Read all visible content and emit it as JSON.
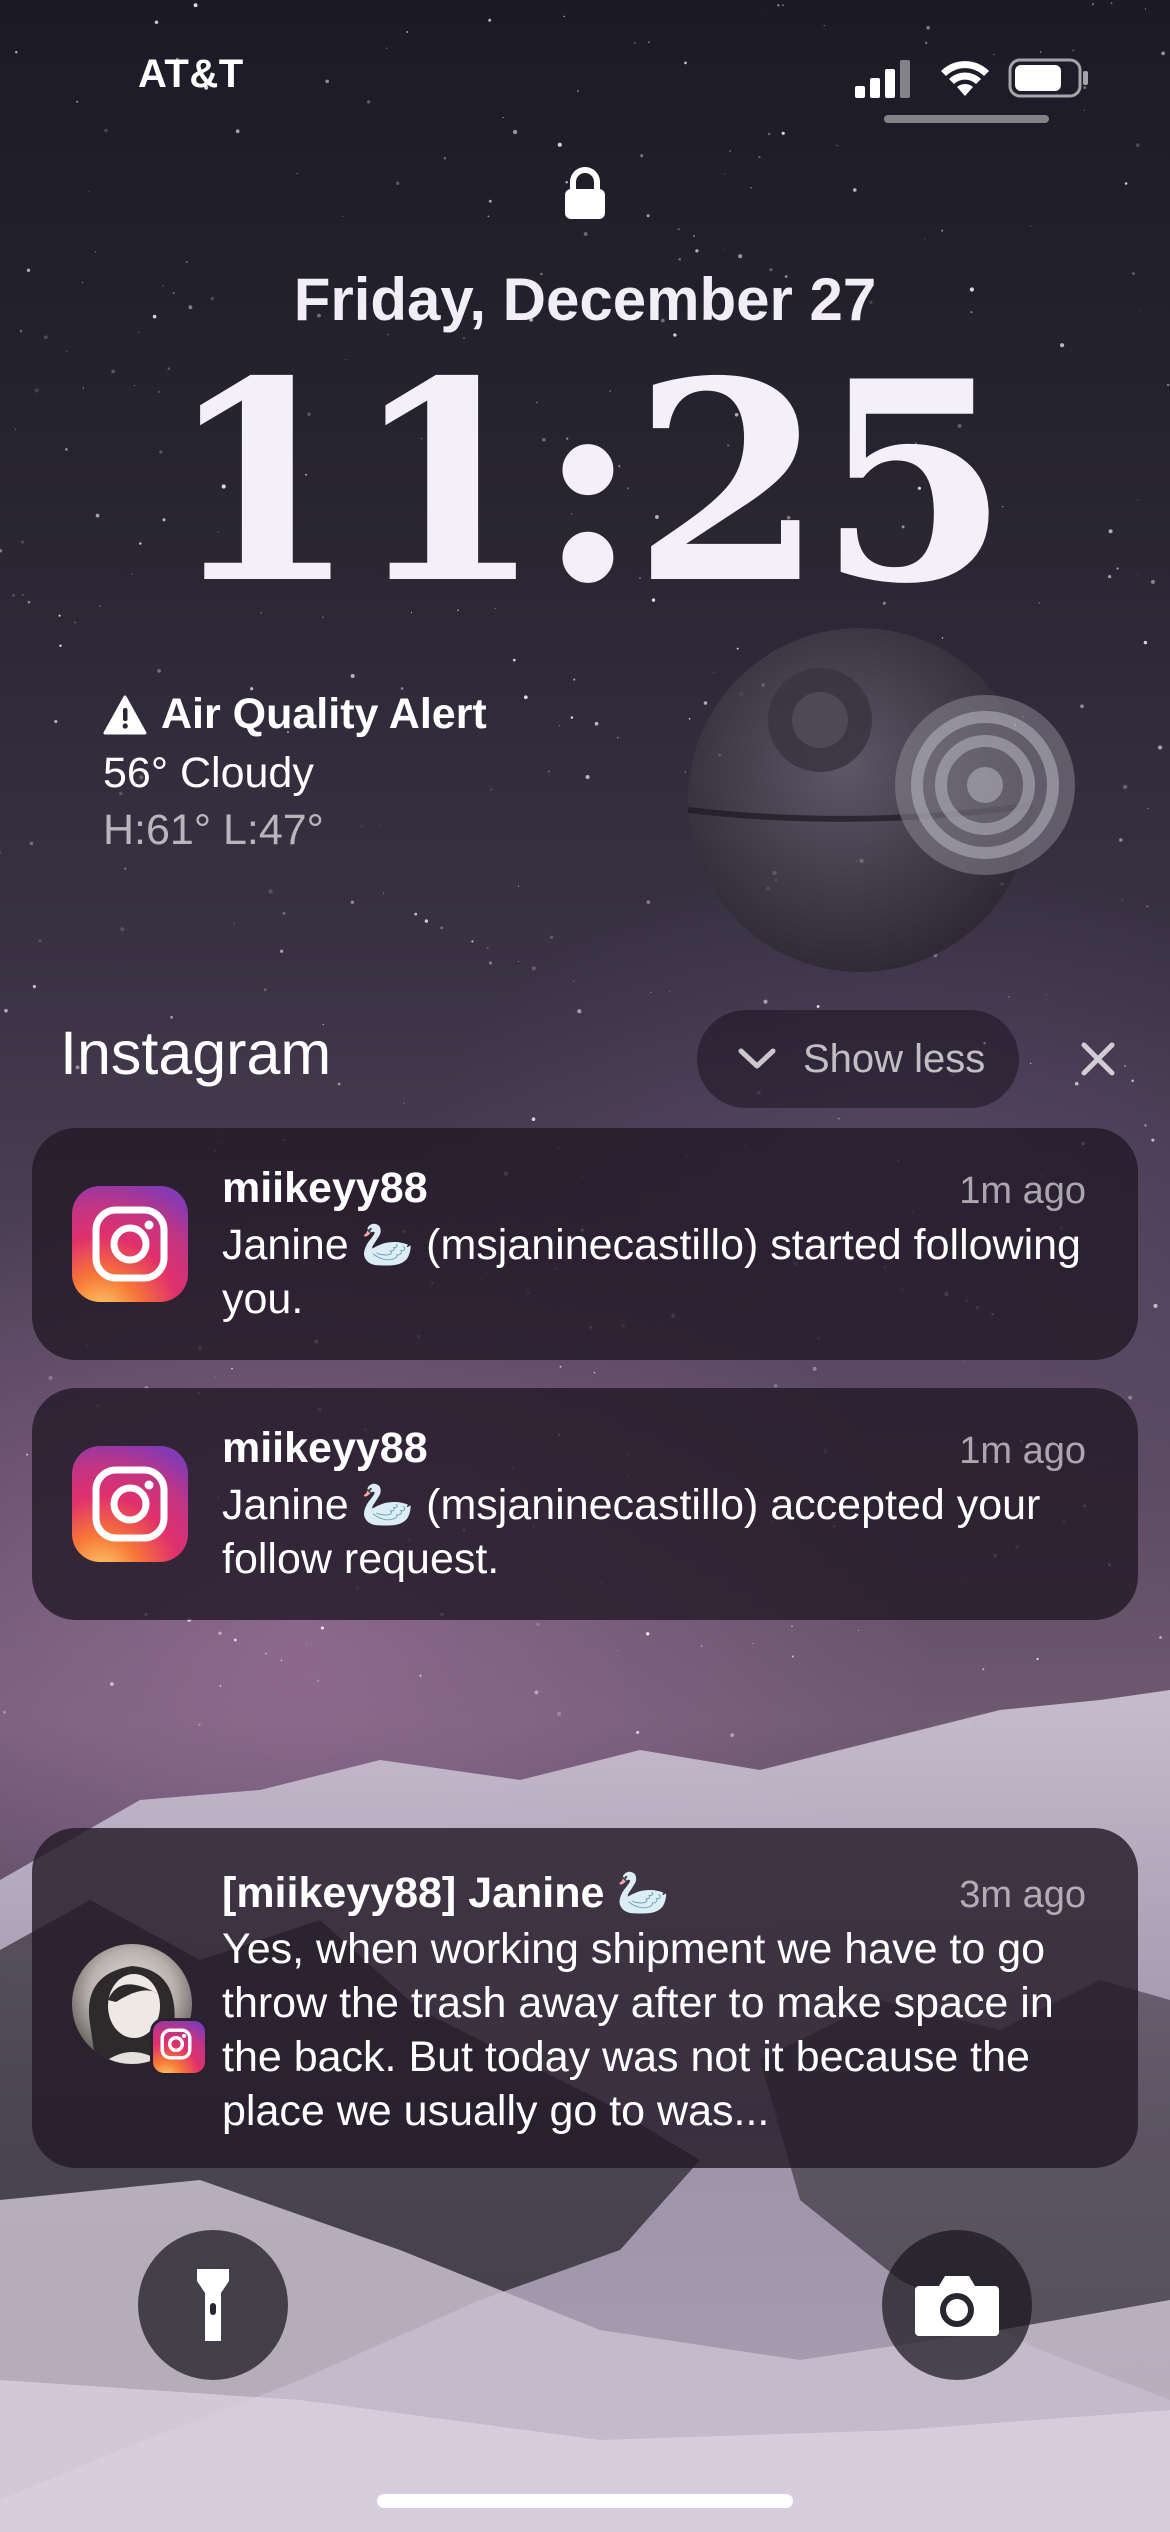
{
  "status_bar": {
    "carrier": "AT&T",
    "icons": [
      "cellular-signal-icon",
      "wifi-icon",
      "battery-icon"
    ]
  },
  "lock_screen": {
    "date": "Friday, December 27",
    "time": "11:25",
    "lock_icon": "lock-icon"
  },
  "weather": {
    "alert": "Air Quality Alert",
    "alert_icon": "warning-icon",
    "current": "56° Cloudy",
    "hi_lo": "H:61° L:47°"
  },
  "notification_group": {
    "app_name": "Instagram",
    "show_less_label": "Show less",
    "close_icon": "close-icon",
    "notifications": [
      {
        "title": "miikeyy88",
        "time": "1m ago",
        "body": "Janine 🦢 (msjaninecastillo) started following you.",
        "icon": "instagram-icon"
      },
      {
        "title": "miikeyy88",
        "time": "1m ago",
        "body": "Janine 🦢 (msjaninecastillo) accepted your follow request.",
        "icon": "instagram-icon"
      }
    ]
  },
  "message_notification": {
    "title": "[miikeyy88] Janine 🦢",
    "time": "3m ago",
    "body": "Yes, when working shipment we have to go throw the trash away after to make space in the back. But today was not it because the place we usually go to was...",
    "icon": "avatar"
  },
  "quick_actions": {
    "left_icon": "flashlight-icon",
    "right_icon": "camera-icon"
  },
  "colors": {
    "card_background": "#231a28",
    "instagram_gradient": [
      "#fdd36b",
      "#f77737",
      "#e1306c",
      "#c13584",
      "#833ab4"
    ]
  }
}
